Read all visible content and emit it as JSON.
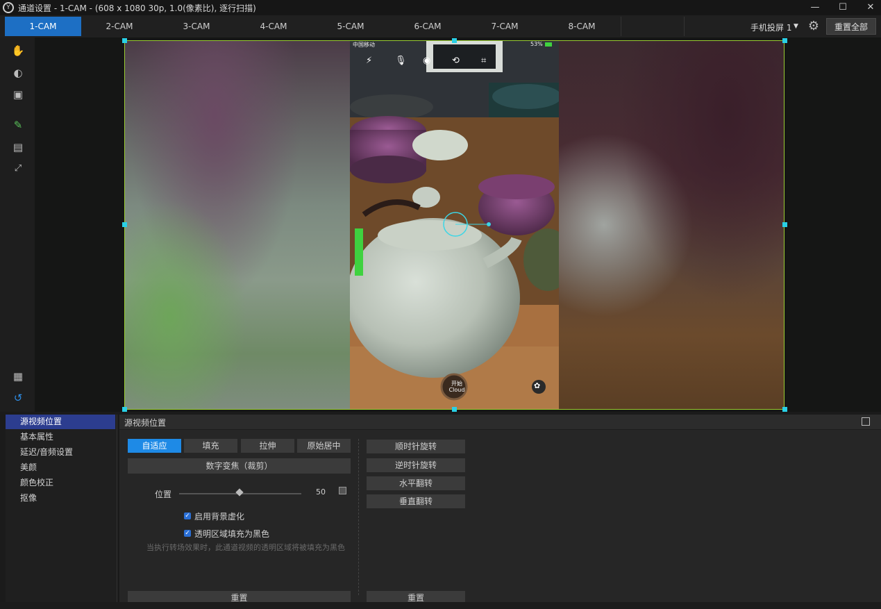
{
  "window": {
    "title": "通道设置 - 1-CAM - (608 x 1080 30p, 1.0(像素比), 逐行扫描)",
    "minimize_glyph": "—",
    "maximize_glyph": "☐",
    "close_glyph": "✕"
  },
  "tabs": [
    {
      "label": "1-CAM",
      "active": true
    },
    {
      "label": "2-CAM"
    },
    {
      "label": "3-CAM"
    },
    {
      "label": "4-CAM"
    },
    {
      "label": "5-CAM"
    },
    {
      "label": "6-CAM"
    },
    {
      "label": "7-CAM"
    },
    {
      "label": "8-CAM"
    }
  ],
  "header": {
    "mirror_select": "手机投屏 1",
    "reset_all": "重置全部"
  },
  "phone": {
    "carrier": "中国移动",
    "battery": "53%",
    "start_line1": "开始",
    "start_line2": "Cloud"
  },
  "sidenav": {
    "items": [
      {
        "label": "源视频位置",
        "active": true
      },
      {
        "label": "基本属性"
      },
      {
        "label": "延迟/音频设置"
      },
      {
        "label": "美颜"
      },
      {
        "label": "颜色校正"
      },
      {
        "label": "抠像"
      }
    ]
  },
  "panel": {
    "title": "源视频位置",
    "mode_buttons": [
      "自适应",
      "填充",
      "拉伸",
      "原始居中"
    ],
    "active_mode": "自适应",
    "digital_zoom": "数字变焦（裁剪）",
    "position_label": "位置",
    "position_value": "50",
    "checkbox_blur": "启用背景虚化",
    "checkbox_fill_black": "透明区域填充为黑色",
    "hint": "当执行转场效果时，此通道视频的透明区域将被填充为黑色",
    "reset_left": "重置",
    "rotate_cw": "顺时针旋转",
    "rotate_ccw": "逆时针旋转",
    "flip_h": "水平翻转",
    "flip_v": "垂直翻转",
    "reset_right": "重置"
  }
}
